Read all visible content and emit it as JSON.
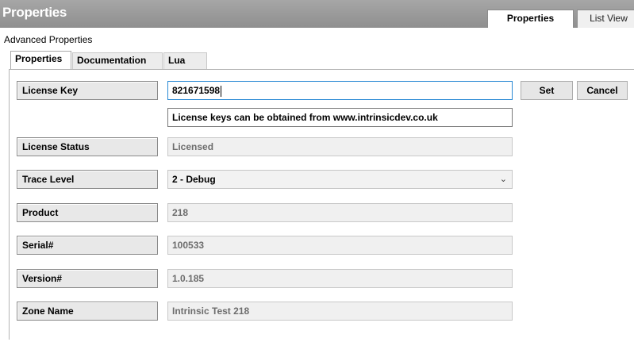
{
  "header": {
    "title": "Properties",
    "view_tabs": [
      "Properties",
      "List View"
    ]
  },
  "section_label": "Advanced Properties",
  "tabs": [
    "Properties",
    "Documentation",
    "Lua"
  ],
  "form": {
    "license_key": {
      "label": "License Key",
      "value": "821671598"
    },
    "license_hint": "License keys can be obtained from www.intrinsicdev.co.uk",
    "license_status": {
      "label": "License Status",
      "value": "Licensed"
    },
    "trace_level": {
      "label": "Trace Level",
      "value": "2 - Debug"
    },
    "product": {
      "label": "Product",
      "value": "218"
    },
    "serial": {
      "label": "Serial#",
      "value": "100533"
    },
    "version": {
      "label": "Version#",
      "value": "1.0.185"
    },
    "zone_name": {
      "label": "Zone Name",
      "value": "Intrinsic Test 218"
    }
  },
  "buttons": {
    "set": "Set",
    "cancel": "Cancel"
  },
  "icons": {
    "dropdown": "chevron-down-icon"
  }
}
